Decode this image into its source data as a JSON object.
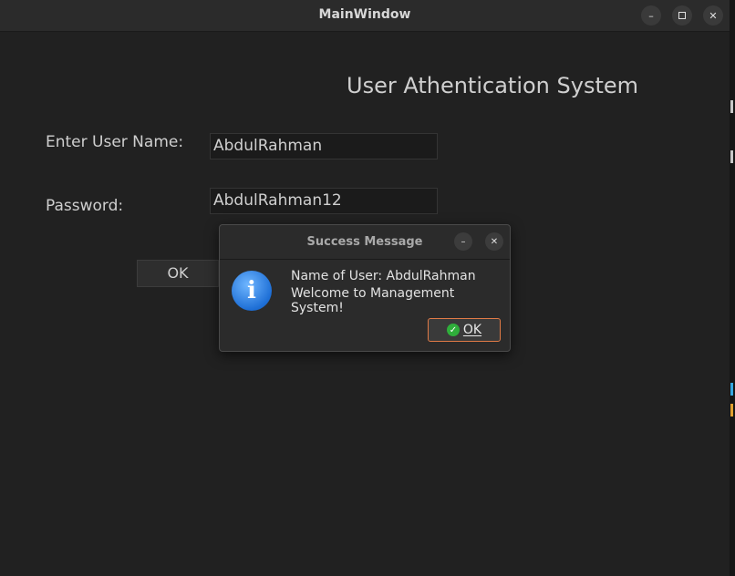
{
  "window": {
    "title": "MainWindow",
    "minimize_icon": "minimize-icon",
    "maximize_icon": "maximize-icon",
    "close_icon": "close-icon"
  },
  "form": {
    "heading": "User Athentication System",
    "username_label": "Enter User Name:",
    "username_value": "AbdulRahman",
    "password_label": "Password:",
    "password_value": "AbdulRahman12",
    "ok_label": "OK"
  },
  "dialog": {
    "title": "Success Message",
    "icon": "info-icon",
    "message_line1": "Name of User: AbdulRahman",
    "message_line2": "Welcome to Management System!",
    "ok_label": "OK",
    "ok_icon": "check-icon",
    "accent_color": "#e07a46"
  },
  "colors": {
    "background": "#212121",
    "titlebar": "#2b2b2b",
    "text": "#cfcfcf",
    "info_blue": "#1e6fd6",
    "check_green": "#2fae3b"
  }
}
